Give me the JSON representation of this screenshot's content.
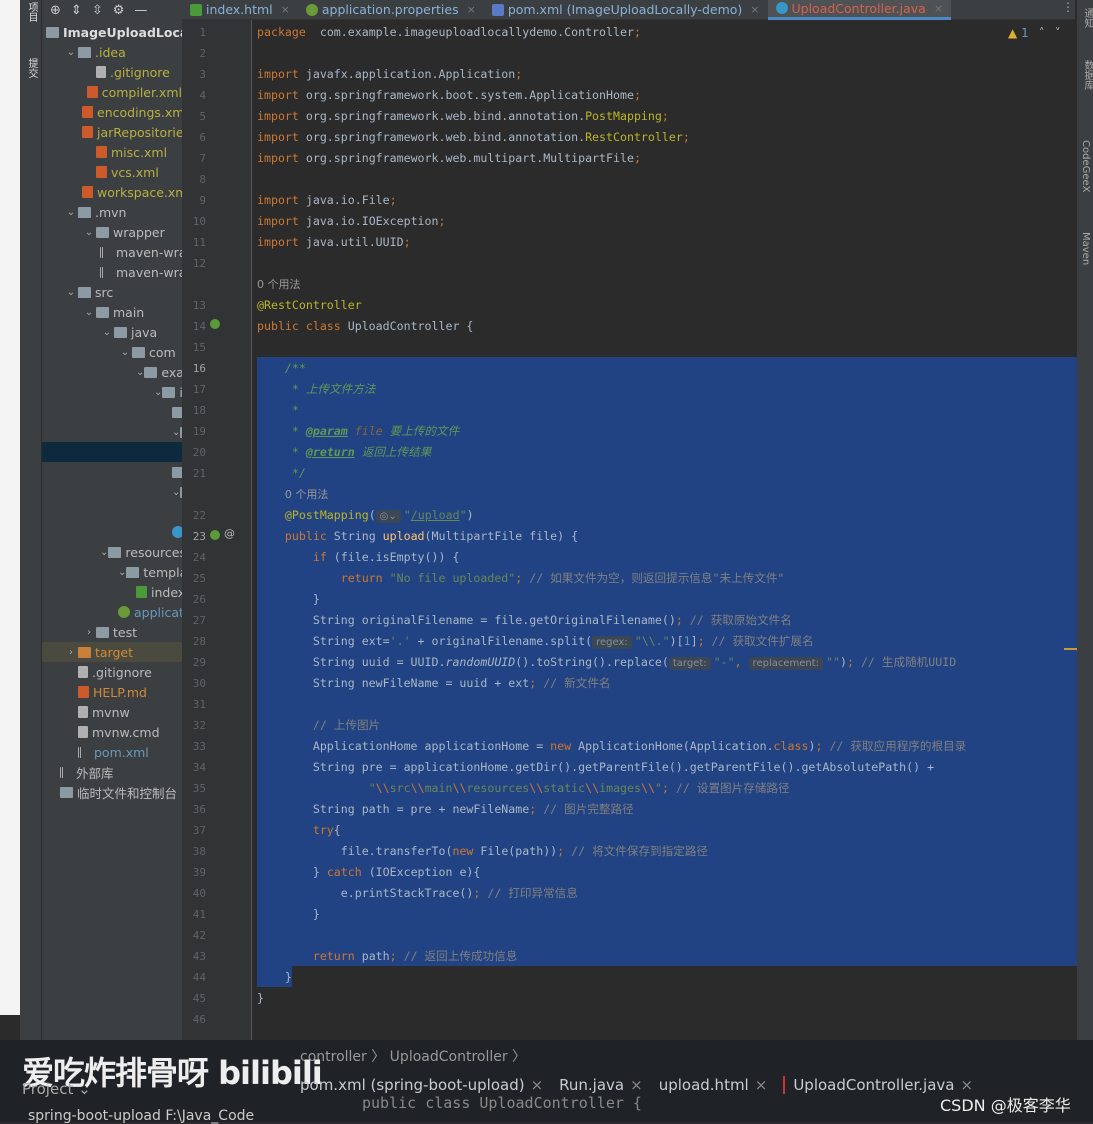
{
  "toolstrip": {
    "project_label": "项目",
    "commit_label": "提交"
  },
  "sidebar": {
    "items": [
      {
        "label": "ImageUploadLocally",
        "level": 0,
        "arrow": "",
        "icon": "module",
        "cls": "bold"
      },
      {
        "label": ".idea",
        "level": 1,
        "arrow": "v",
        "icon": "folder",
        "cls": "y"
      },
      {
        "label": ".gitignore",
        "level": 2,
        "arrow": "",
        "icon": "file",
        "cls": "y"
      },
      {
        "label": "compiler.xml",
        "level": 2,
        "arrow": "",
        "icon": "xml",
        "cls": "y"
      },
      {
        "label": "encodings.xml",
        "level": 2,
        "arrow": "",
        "icon": "xml",
        "cls": "y"
      },
      {
        "label": "jarRepositorie",
        "level": 2,
        "arrow": "",
        "icon": "xml",
        "cls": "y"
      },
      {
        "label": "misc.xml",
        "level": 2,
        "arrow": "",
        "icon": "xml",
        "cls": "y"
      },
      {
        "label": "vcs.xml",
        "level": 2,
        "arrow": "",
        "icon": "xml",
        "cls": "y"
      },
      {
        "label": "workspace.xm",
        "level": 2,
        "arrow": "",
        "icon": "xml",
        "cls": "y"
      },
      {
        "label": ".mvn",
        "level": 1,
        "arrow": "v",
        "icon": "folder",
        "cls": ""
      },
      {
        "label": "wrapper",
        "level": 2,
        "arrow": "v",
        "icon": "folder",
        "cls": ""
      },
      {
        "label": "maven-wra",
        "level": 3,
        "arrow": "",
        "icon": "lib",
        "cls": ""
      },
      {
        "label": "maven-wra",
        "level": 3,
        "arrow": "",
        "icon": "lib",
        "cls": ""
      },
      {
        "label": "src",
        "level": 1,
        "arrow": "v",
        "icon": "folder",
        "cls": ""
      },
      {
        "label": "main",
        "level": 2,
        "arrow": "v",
        "icon": "folder",
        "cls": ""
      },
      {
        "label": "java",
        "level": 3,
        "arrow": "v",
        "icon": "folder",
        "cls": ""
      },
      {
        "label": "com",
        "level": 4,
        "arrow": "v",
        "icon": "folder",
        "cls": ""
      },
      {
        "label": "exam",
        "level": 5,
        "arrow": "v",
        "icon": "folder",
        "cls": ""
      },
      {
        "label": "im",
        "level": 6,
        "arrow": "v",
        "icon": "folder",
        "cls": ""
      },
      {
        "label": "",
        "level": 7,
        "arrow": "",
        "icon": "folder",
        "cls": ""
      },
      {
        "label": "",
        "level": 7,
        "arrow": "v",
        "icon": "folder",
        "cls": ""
      },
      {
        "label": "",
        "level": 7,
        "arrow": "",
        "icon": "none",
        "cls": "",
        "selected": true
      },
      {
        "label": "",
        "level": 7,
        "arrow": "",
        "icon": "folder",
        "cls": ""
      },
      {
        "label": "",
        "level": 7,
        "arrow": "v",
        "icon": "folder",
        "cls": ""
      },
      {
        "label": "",
        "level": 8,
        "arrow": "",
        "icon": "none",
        "cls": ""
      },
      {
        "label": "",
        "level": 7,
        "arrow": "",
        "icon": "cls",
        "cls": ""
      },
      {
        "label": "resources",
        "level": 3,
        "arrow": "v",
        "icon": "folder",
        "cls": ""
      },
      {
        "label": "template",
        "level": 4,
        "arrow": "v",
        "icon": "folder",
        "cls": ""
      },
      {
        "label": "index",
        "level": 5,
        "arrow": "",
        "icon": "html",
        "cls": ""
      },
      {
        "label": "applicat",
        "level": 4,
        "arrow": "",
        "icon": "spring",
        "cls": "b"
      },
      {
        "label": "test",
        "level": 2,
        "arrow": ">",
        "icon": "folder",
        "cls": ""
      },
      {
        "label": "target",
        "level": 1,
        "arrow": ">",
        "icon": "folder-orange",
        "cls": "o",
        "target": true
      },
      {
        "label": ".gitignore",
        "level": 1,
        "arrow": "",
        "icon": "file",
        "cls": ""
      },
      {
        "label": "HELP.md",
        "level": 1,
        "arrow": "",
        "icon": "md",
        "cls": "o"
      },
      {
        "label": "mvnw",
        "level": 1,
        "arrow": "",
        "icon": "file",
        "cls": ""
      },
      {
        "label": "mvnw.cmd",
        "level": 1,
        "arrow": "",
        "icon": "file",
        "cls": ""
      },
      {
        "label": "pom.xml",
        "level": 1,
        "arrow": "",
        "icon": "maven",
        "cls": "b"
      },
      {
        "label": "外部库",
        "level": 0,
        "arrow": "",
        "icon": "lib",
        "cls": ""
      },
      {
        "label": "临时文件和控制台",
        "level": 0,
        "arrow": "",
        "icon": "scratch",
        "cls": ""
      }
    ]
  },
  "tabs": [
    {
      "label": "index.html",
      "icon": "html-icon",
      "color": "#4a9a3a",
      "active": false
    },
    {
      "label": "application.properties",
      "icon": "spring-icon",
      "color": "#6a9a3a",
      "active": false
    },
    {
      "label": "pom.xml (ImageUploadLocally-demo)",
      "icon": "maven-icon",
      "color": "#5a7ac8",
      "active": false
    },
    {
      "label": "UploadController.java",
      "icon": "class-icon",
      "color": "#3a95c8",
      "active": true
    }
  ],
  "inspections": {
    "warnings": "1",
    "icon": "warning-icon"
  },
  "right_tools": [
    "通知",
    "数据库",
    "CodeGeeX",
    "Maven"
  ],
  "code": [
    {
      "n": "1",
      "t": [
        [
          "k",
          "package"
        ],
        [
          "",
          "  com.example.imageuploadlocallydemo.Controller"
        ],
        [
          "p",
          ";"
        ]
      ]
    },
    {
      "n": "2",
      "t": []
    },
    {
      "n": "3",
      "t": [
        [
          "k",
          "import"
        ],
        [
          "",
          " javafx.application.Application"
        ],
        [
          "p",
          ";"
        ]
      ]
    },
    {
      "n": "4",
      "t": [
        [
          "k",
          "import"
        ],
        [
          "",
          " org.springframework.boot.system.ApplicationHome"
        ],
        [
          "p",
          ";"
        ]
      ]
    },
    {
      "n": "5",
      "t": [
        [
          "k",
          "import"
        ],
        [
          "",
          " org.springframework.web.bind.annotation."
        ],
        [
          "a",
          "PostMapping"
        ],
        [
          "p",
          ";"
        ]
      ]
    },
    {
      "n": "6",
      "t": [
        [
          "k",
          "import"
        ],
        [
          "",
          " org.springframework.web.bind.annotation."
        ],
        [
          "a",
          "RestController"
        ],
        [
          "p",
          ";"
        ]
      ]
    },
    {
      "n": "7",
      "t": [
        [
          "k",
          "import"
        ],
        [
          "",
          " org.springframework.web.multipart.MultipartFile"
        ],
        [
          "p",
          ";"
        ]
      ]
    },
    {
      "n": "8",
      "t": []
    },
    {
      "n": "9",
      "t": [
        [
          "k",
          "import"
        ],
        [
          "",
          " java.io.File"
        ],
        [
          "p",
          ";"
        ]
      ]
    },
    {
      "n": "10",
      "t": [
        [
          "k",
          "import"
        ],
        [
          "",
          " java.io.IOException"
        ],
        [
          "p",
          ";"
        ]
      ]
    },
    {
      "n": "11",
      "t": [
        [
          "k",
          "import"
        ],
        [
          "",
          " java.util.UUID"
        ],
        [
          "p",
          ";"
        ]
      ]
    },
    {
      "n": "12",
      "t": []
    },
    {
      "n": "",
      "t": [
        [
          "usage",
          "0 个用法"
        ]
      ]
    },
    {
      "n": "13",
      "t": [
        [
          "a",
          "@RestController"
        ]
      ]
    },
    {
      "n": "14",
      "t": [
        [
          "k",
          "public class"
        ],
        [
          "",
          " UploadController {"
        ]
      ]
    },
    {
      "n": "15",
      "t": []
    },
    {
      "n": "16",
      "t": [
        [
          "d",
          "    /**"
        ]
      ]
    },
    {
      "n": "17",
      "t": [
        [
          "d",
          "     * 上传文件方法"
        ]
      ]
    },
    {
      "n": "18",
      "t": [
        [
          "d",
          "     *"
        ]
      ]
    },
    {
      "n": "19",
      "t": [
        [
          "d",
          "     * "
        ],
        [
          "dt",
          "@param"
        ],
        [
          "dv",
          " file"
        ],
        [
          "d",
          " 要上传的文件"
        ]
      ]
    },
    {
      "n": "20",
      "t": [
        [
          "d",
          "     * "
        ],
        [
          "dt",
          "@return"
        ],
        [
          "d",
          " 返回上传结果"
        ]
      ]
    },
    {
      "n": "21",
      "t": [
        [
          "d",
          "     */"
        ]
      ]
    },
    {
      "n": "",
      "t": [
        [
          "",
          "    "
        ],
        [
          "usage",
          "0 个用法"
        ]
      ]
    },
    {
      "n": "22",
      "t": [
        [
          "a",
          "    @PostMapping"
        ],
        [
          "",
          "("
        ],
        [
          "h",
          "◎⌄"
        ],
        [
          "s",
          "\""
        ],
        [
          "u",
          "/upload"
        ],
        [
          "s",
          "\""
        ],
        [
          "",
          ")"
        ]
      ]
    },
    {
      "n": "23",
      "t": [
        [
          "k",
          "    public"
        ],
        [
          "",
          " String "
        ],
        [
          "f",
          "upload"
        ],
        [
          "",
          "(MultipartFile file) {"
        ]
      ]
    },
    {
      "n": "24",
      "t": [
        [
          "k",
          "        if"
        ],
        [
          "",
          " (file.isEmpty()) {"
        ]
      ]
    },
    {
      "n": "25",
      "t": [
        [
          "k",
          "            return"
        ],
        [
          "s",
          " \"No file uploaded\""
        ],
        [
          "p",
          ";"
        ],
        [
          "c",
          " // 如果文件为空，则返回提示信息\"未上传文件\""
        ]
      ]
    },
    {
      "n": "26",
      "t": [
        [
          "",
          "        }"
        ]
      ]
    },
    {
      "n": "27",
      "t": [
        [
          "",
          "        String originalFilename = file.getOriginalFilename()"
        ],
        [
          "p",
          ";"
        ],
        [
          "c",
          " // 获取原始文件名"
        ]
      ]
    },
    {
      "n": "28",
      "t": [
        [
          "",
          "        String ext="
        ],
        [
          "s",
          "'.'"
        ],
        [
          "",
          " + originalFilename.split("
        ],
        [
          "h",
          "regex:"
        ],
        [
          "s",
          "\"\\\\.\""
        ],
        [
          "",
          ")["
        ],
        [
          "num",
          "1"
        ],
        [
          "",
          "]"
        ],
        [
          "p",
          ";"
        ],
        [
          "c",
          " // 获取文件扩展名"
        ]
      ]
    },
    {
      "n": "29",
      "t": [
        [
          "",
          "        String uuid = UUID."
        ],
        [
          "it",
          "randomUUID"
        ],
        [
          "",
          "().toString().replace("
        ],
        [
          "h",
          "target:"
        ],
        [
          "s",
          "\"-\""
        ],
        [
          "p",
          ", "
        ],
        [
          "h",
          "replacement:"
        ],
        [
          "s",
          "\"\""
        ],
        [
          "",
          ")"
        ],
        [
          "p",
          ";"
        ],
        [
          "c",
          " // 生成随机UUID"
        ]
      ]
    },
    {
      "n": "30",
      "t": [
        [
          "",
          "        String newFileName = uuid + ext"
        ],
        [
          "p",
          ";"
        ],
        [
          "c",
          " // 新文件名"
        ]
      ]
    },
    {
      "n": "31",
      "t": []
    },
    {
      "n": "32",
      "t": [
        [
          "c",
          "        // 上传图片"
        ]
      ]
    },
    {
      "n": "33",
      "t": [
        [
          "",
          "        ApplicationHome applicationHome = "
        ],
        [
          "k",
          "new"
        ],
        [
          "",
          " ApplicationHome(Application."
        ],
        [
          "k",
          "class"
        ],
        [
          "",
          ")"
        ],
        [
          "p",
          ";"
        ],
        [
          "c",
          " // 获取应用程序的根目录"
        ]
      ]
    },
    {
      "n": "34",
      "t": [
        [
          "",
          "        String pre = applicationHome.getDir().getParentFile().getParentFile().getAbsolutePath() +"
        ]
      ]
    },
    {
      "n": "35",
      "t": [
        [
          "s",
          "                \""
        ],
        [
          "p",
          "\\\\"
        ],
        [
          "s",
          "src"
        ],
        [
          "p",
          "\\\\"
        ],
        [
          "s",
          "main"
        ],
        [
          "p",
          "\\\\"
        ],
        [
          "s",
          "resources"
        ],
        [
          "p",
          "\\\\"
        ],
        [
          "s",
          "static"
        ],
        [
          "p",
          "\\\\"
        ],
        [
          "s",
          "images"
        ],
        [
          "p",
          "\\\\"
        ],
        [
          "s",
          "\""
        ],
        [
          "p",
          ";"
        ],
        [
          "c",
          " // 设置图片存储路径"
        ]
      ]
    },
    {
      "n": "36",
      "t": [
        [
          "",
          "        String path = pre + newFileName"
        ],
        [
          "p",
          ";"
        ],
        [
          "c",
          " // 图片完整路径"
        ]
      ]
    },
    {
      "n": "37",
      "t": [
        [
          "k",
          "        try"
        ],
        [
          "",
          "{"
        ]
      ]
    },
    {
      "n": "38",
      "t": [
        [
          "",
          "            file.transferTo("
        ],
        [
          "k",
          "new"
        ],
        [
          "",
          " File(path))"
        ],
        [
          "p",
          ";"
        ],
        [
          "c",
          " // 将文件保存到指定路径"
        ]
      ]
    },
    {
      "n": "39",
      "t": [
        [
          "",
          "        } "
        ],
        [
          "k",
          "catch"
        ],
        [
          "",
          " (IOException e){"
        ]
      ]
    },
    {
      "n": "40",
      "t": [
        [
          "",
          "            e.printStackTrace()"
        ],
        [
          "p",
          ";"
        ],
        [
          "c",
          " // 打印异常信息"
        ]
      ]
    },
    {
      "n": "41",
      "t": [
        [
          "",
          "        }"
        ]
      ]
    },
    {
      "n": "42",
      "t": []
    },
    {
      "n": "43",
      "t": [
        [
          "k",
          "        return"
        ],
        [
          "",
          " path"
        ],
        [
          "p",
          ";"
        ],
        [
          "c",
          " // 返回上传成功信息"
        ]
      ]
    },
    {
      "n": "44",
      "t": [
        [
          "",
          "    }"
        ]
      ]
    },
    {
      "n": "45",
      "t": [
        [
          "",
          "}"
        ]
      ]
    },
    {
      "n": "46",
      "t": []
    }
  ],
  "overlay": {
    "watermark": "爱吃炸排骨呀 bilibili",
    "breadcrumb": "controller 〉 UploadController 〉",
    "tabs": [
      "pom.xml (spring-boot-upload)",
      "Run.java",
      "upload.html",
      "UploadController.java"
    ],
    "project": "Project ⌄",
    "project_root": "spring-boot-upload  F:\\Java_Code",
    "code": "public class UploadController {",
    "csdn": "CSDN @极客李华"
  }
}
